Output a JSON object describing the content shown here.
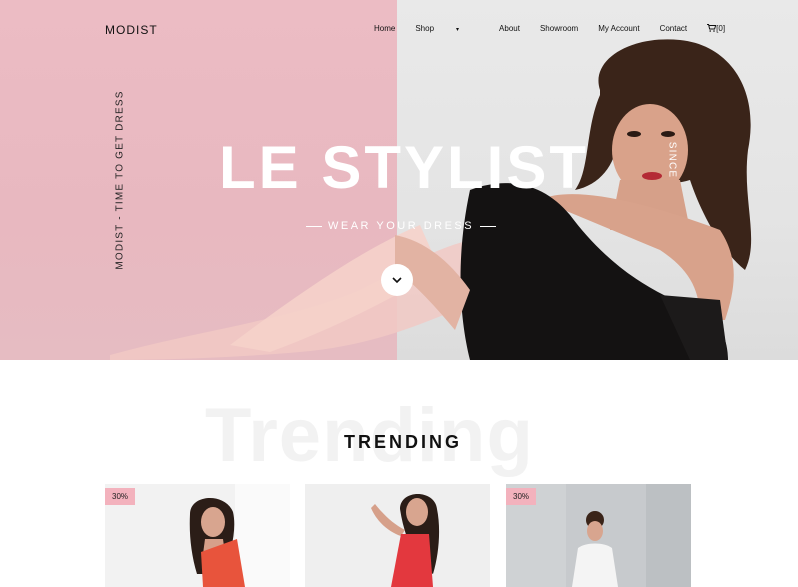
{
  "brand": {
    "logo": "MODIST"
  },
  "nav": {
    "items": [
      {
        "label": "Home",
        "has_caret": false
      },
      {
        "label": "Shop",
        "has_caret": true
      },
      {
        "label": "About",
        "has_caret": false
      },
      {
        "label": "Showroom",
        "has_caret": false
      },
      {
        "label": "My Account",
        "has_caret": false
      },
      {
        "label": "Contact",
        "has_caret": false
      }
    ],
    "cart_label": "[0]",
    "cart_icon": "cart-icon"
  },
  "hero": {
    "side_text": "MODIST - TIME TO GET DRESS",
    "since_text": "SINCE",
    "title": "LE STYLIST",
    "subtitle": "WEAR YOUR DRESS",
    "scroll_icon": "chevron-down-icon",
    "colors": {
      "left_panel": "#ecbcc4",
      "right_panel": "#e6e6e6"
    }
  },
  "trending": {
    "background_word": "Trending",
    "title": "TRENDING",
    "cards": [
      {
        "badge": "30%",
        "background": "#f2f2f2",
        "dress_color": "#e8543c"
      },
      {
        "badge": "",
        "background": "#efefef",
        "dress_color": "#e3383e"
      },
      {
        "badge": "30%",
        "background": "#c7cacd",
        "dress_color": "#f4f4f4"
      }
    ]
  }
}
